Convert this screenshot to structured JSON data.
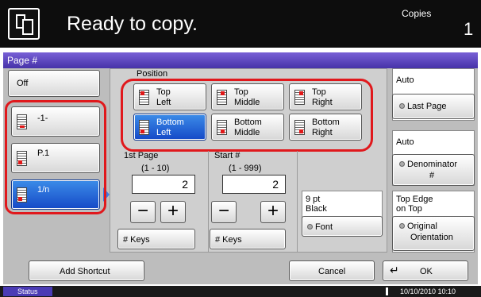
{
  "header": {
    "title": "Ready to copy.",
    "copies_label": "Copies",
    "copies_value": "1"
  },
  "panel": {
    "title": "Page #",
    "page_type": {
      "off_label": "Off",
      "dash_label": "-1-",
      "p_label": "P.1",
      "n_label": "1/n",
      "selected": "1/n"
    },
    "position": {
      "heading": "Position",
      "items": [
        [
          "Top",
          "Left"
        ],
        [
          "Top",
          "Middle"
        ],
        [
          "Top",
          "Right"
        ],
        [
          "Bottom",
          "Left"
        ],
        [
          "Bottom",
          "Middle"
        ],
        [
          "Bottom",
          "Right"
        ]
      ],
      "selected": "Bottom Left"
    },
    "first_page": {
      "label": "1st Page",
      "range": "(1 - 10)",
      "value": "2",
      "keys_label": "# Keys"
    },
    "start_num": {
      "label": "Start #",
      "range": "(1 - 999)",
      "value": "2",
      "keys_label": "# Keys"
    },
    "font": {
      "value_line1": "9 pt",
      "value_line2": "Black",
      "button_label": "Font"
    },
    "last_page": {
      "value": "Auto",
      "button_label": "Last Page"
    },
    "denominator": {
      "value": "Auto",
      "button_line1": "Denominator",
      "button_line2": "#"
    },
    "orientation": {
      "value_line1": "Top Edge",
      "value_line2": "on Top",
      "button_line1": "Original",
      "button_line2": "Orientation"
    }
  },
  "footer": {
    "add_shortcut": "Add Shortcut",
    "cancel": "Cancel",
    "ok": "OK",
    "status": "Status",
    "datetime": "10/10/2010 10:10"
  }
}
